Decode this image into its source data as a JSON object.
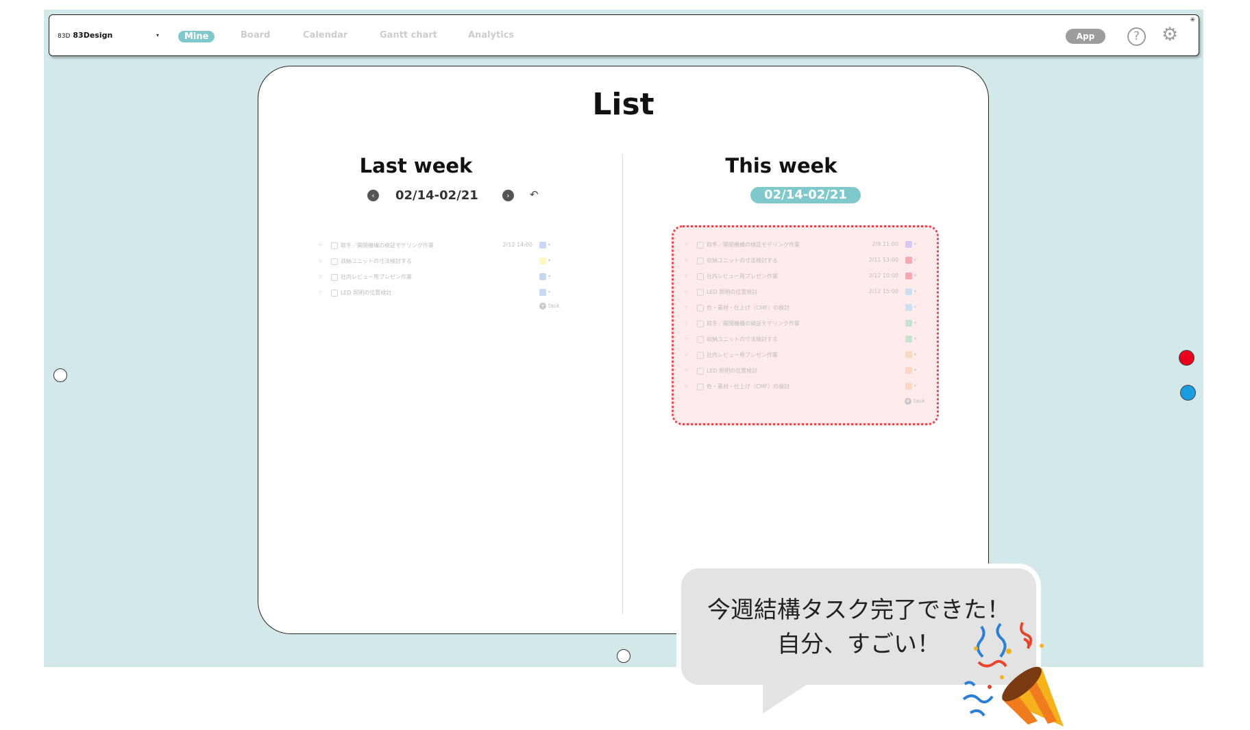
{
  "topbar": {
    "brand_logo": "83D",
    "brand": "83Design",
    "tabs": [
      "Mine",
      "Board",
      "Calendar",
      "Gantt chart",
      "Analytics"
    ],
    "app_button": "App",
    "help": "?",
    "corner": "✳"
  },
  "main": {
    "title": "List",
    "last_week": {
      "title": "Last week",
      "range": "02/14-02/21",
      "tasks": [
        {
          "name": "取手／開閉機構の検証モデリング作業",
          "date": "2/12 14:00",
          "color": "#c9d7f5"
        },
        {
          "name": "収納ユニットの寸法検討する",
          "date": "",
          "color": "#fff6c2"
        },
        {
          "name": "社内レビュー用プレゼン作業",
          "date": "",
          "color": "#c9d7f5"
        },
        {
          "name": "LED 照明の位置検討",
          "date": "",
          "color": "#c9d7f5"
        }
      ],
      "add_label": "task"
    },
    "this_week": {
      "title": "This week",
      "range": "02/14-02/21",
      "tasks": [
        {
          "name": "取手／開閉機構の検証モデリング作業",
          "date": "2/9 11:00",
          "color": "#d8c9f2"
        },
        {
          "name": "収納ユニットの寸法検討する",
          "date": "2/11 13:00",
          "color": "#f7a7b4"
        },
        {
          "name": "社内レビュー用プレゼン作業",
          "date": "2/12 10:00",
          "color": "#f7a7b4"
        },
        {
          "name": "LED 照明の位置検討",
          "date": "2/12 15:00",
          "color": "#c9dff2"
        },
        {
          "name": "色・素材・仕上げ（CMF）の検討",
          "date": "",
          "color": "#c9dff2"
        },
        {
          "name": "取手／開閉機構の検証モデリング作業",
          "date": "",
          "color": "#c6e3cf"
        },
        {
          "name": "収納ユニットの寸法検討する",
          "date": "",
          "color": "#c6e3cf"
        },
        {
          "name": "社内レビュー用プレゼン作業",
          "date": "",
          "color": "#fcd8c4"
        },
        {
          "name": "LED 照明の位置検討",
          "date": "",
          "color": "#fcd8c4"
        },
        {
          "name": "色・素材・仕上げ（CMF）の検討",
          "date": "",
          "color": "#fcd8c4"
        }
      ],
      "add_label": "task"
    }
  },
  "bubble": {
    "line1": "今週結構タスク完了できた！",
    "line2": "自分、すごい！"
  },
  "colors": {
    "background": "#d2e8e9",
    "accent": "#7fc9cc",
    "highlight_border": "#e9434b",
    "dot_red": "#e8001c",
    "dot_blue": "#1a9de0"
  },
  "icons": {
    "prev": "chevron-left-icon",
    "next": "chevron-right-icon",
    "reset": "undo-icon",
    "help": "help-icon",
    "settings": "gear-icon",
    "celebration": "party-popper-icon"
  }
}
